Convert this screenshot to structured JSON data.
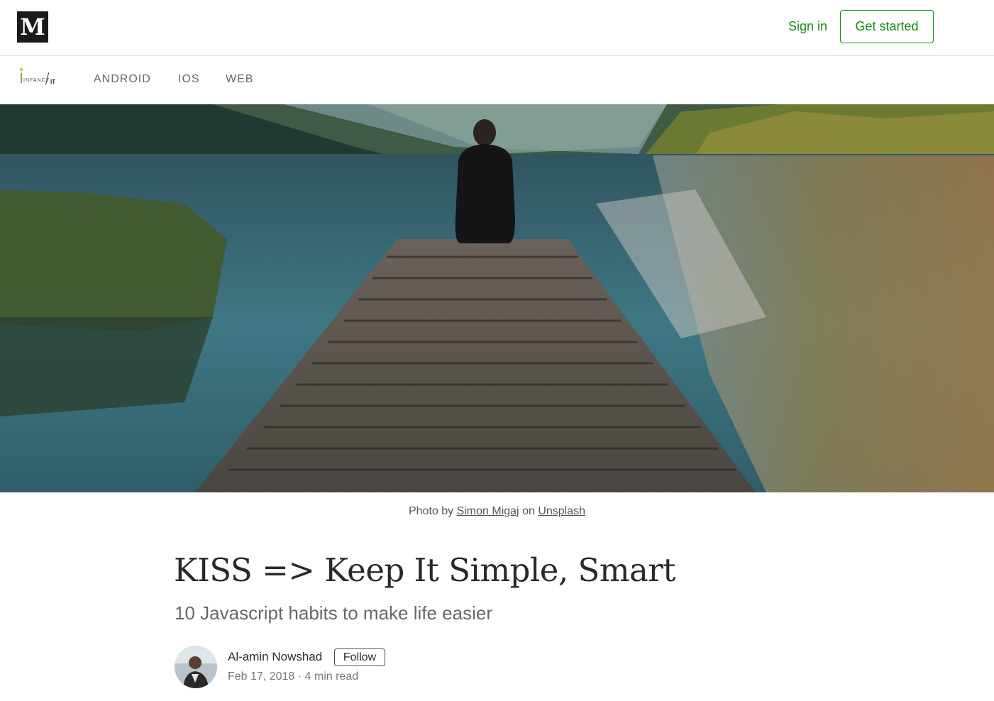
{
  "header": {
    "logo_letter": "M",
    "signin_label": "Sign in",
    "getstarted_label": "Get started",
    "accent_color": "#1a8917"
  },
  "publication": {
    "logo_text": "INFANCY",
    "logo_suffix": "IT",
    "nav": [
      "ANDROID",
      "IOS",
      "WEB"
    ]
  },
  "hero": {
    "icon": "lake-dock-photo"
  },
  "caption": {
    "prefix": "Photo by",
    "photographer": "Simon Migaj",
    "joiner": "on",
    "source": "Unsplash"
  },
  "article": {
    "title": "KISS => Keep It Simple, Smart",
    "subtitle": "10 Javascript habits to make life easier"
  },
  "author": {
    "name": "Al-amin Nowshad",
    "follow_label": "Follow",
    "date": "Feb 17, 2018",
    "separator": "·",
    "read_time": "4 min read"
  }
}
